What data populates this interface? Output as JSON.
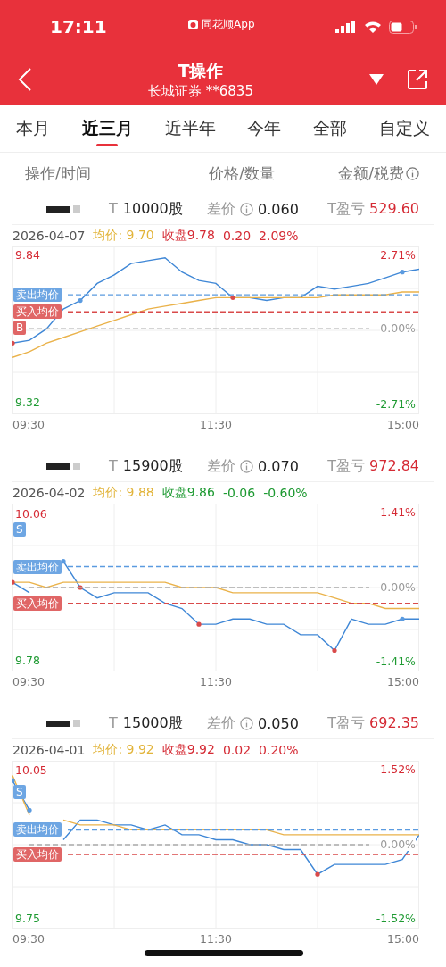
{
  "status_bar": {
    "time": "17:11",
    "app_label": "同花顺App"
  },
  "header": {
    "title": "T操作",
    "subtitle": "长城证券 **6835"
  },
  "tabs": [
    {
      "label": "本月",
      "selected": false
    },
    {
      "label": "近三月",
      "selected": true
    },
    {
      "label": "近半年",
      "selected": false
    },
    {
      "label": "今年",
      "selected": false
    },
    {
      "label": "全部",
      "selected": false
    },
    {
      "label": "自定义",
      "selected": false
    }
  ],
  "columns": [
    "操作/时间",
    "价格/数量",
    "金额/税费"
  ],
  "trades": [
    {
      "prefix": "T",
      "quantity": "10000股",
      "spread_label": "差价",
      "spread": "0.060",
      "pnl_label": "T盈亏",
      "pnl": "529.60",
      "date": "2026-04-07",
      "avg_label": "均价:",
      "avg": "9.70",
      "close_label": "收盘",
      "close": "9.78",
      "change": "0.20",
      "change_pct": "2.09%",
      "rising": true,
      "high_pct": "2.71%",
      "low_pct": "-2.71%",
      "marker": "B",
      "times": [
        "09:30",
        "11:30",
        "15:00"
      ],
      "chart_data": {
        "type": "line",
        "grid": true,
        "series": [
          {
            "color": "#3f87d6",
            "values": [
              9.53,
              9.54,
              9.58,
              9.65,
              9.68,
              9.74,
              9.77,
              9.81,
              9.82,
              9.83,
              9.78,
              9.75,
              9.74,
              9.69,
              9.69,
              9.68,
              9.69,
              9.69,
              9.73,
              9.72,
              9.73,
              9.74,
              9.76,
              9.78,
              9.79
            ]
          },
          {
            "color": "#eab24a",
            "values": [
              9.48,
              9.5,
              9.53,
              9.55,
              9.57,
              9.59,
              9.61,
              9.63,
              9.65,
              9.66,
              9.67,
              9.68,
              9.69,
              9.69,
              9.69,
              9.69,
              9.69,
              9.69,
              9.69,
              9.7,
              9.7,
              9.7,
              9.7,
              9.71,
              9.71
            ]
          }
        ],
        "ylim": [
          9.28,
          9.87
        ],
        "yticks": [
          {
            "value": 9.32,
            "label": "9.32"
          },
          {
            "value": 9.84,
            "label": "9.84"
          }
        ]
      },
      "zero_pct": "0.00%",
      "sell_avg_label": "卖出均价",
      "buy_avg_label": "买入均价"
    },
    {
      "prefix": "T",
      "quantity": "15900股",
      "spread_label": "差价",
      "spread": "0.070",
      "pnl_label": "T盈亏",
      "pnl": "972.84",
      "date": "2026-04-02",
      "avg_label": "均价:",
      "avg": "9.88",
      "close_label": "收盘",
      "close": "9.86",
      "change": "-0.06",
      "change_pct": "-0.60%",
      "rising": false,
      "high_pct": "1.41%",
      "low_pct": "-1.41%",
      "marker": "S",
      "times": [
        "09:30",
        "11:30",
        "15:00"
      ],
      "chart_data": {
        "type": "line",
        "grid": true,
        "series": [
          {
            "color": "#3f87d6",
            "values": [
              9.93,
              9.91,
              null,
              9.97,
              9.92,
              9.9,
              9.91,
              9.91,
              9.91,
              9.89,
              9.88,
              9.85,
              9.85,
              9.86,
              9.86,
              9.85,
              9.85,
              9.83,
              9.83,
              9.8,
              9.86,
              9.85,
              9.85,
              9.86,
              9.86
            ]
          },
          {
            "color": "#eab24a",
            "values": [
              9.93,
              9.93,
              9.92,
              9.93,
              9.93,
              9.93,
              9.93,
              9.93,
              9.93,
              9.93,
              9.92,
              9.92,
              9.92,
              9.91,
              9.91,
              9.91,
              9.91,
              9.91,
              9.91,
              9.9,
              9.89,
              9.89,
              9.88,
              9.88,
              9.88
            ]
          }
        ],
        "ylim": [
          9.76,
          10.08
        ],
        "yticks": [
          {
            "value": 9.78,
            "label": "9.78"
          },
          {
            "value": 10.06,
            "label": "10.06"
          }
        ]
      },
      "zero_pct": "0.00%",
      "sell_avg_label": "卖出均价",
      "buy_avg_label": "买入均价"
    },
    {
      "prefix": "T",
      "quantity": "15000股",
      "spread_label": "差价",
      "spread": "0.050",
      "pnl_label": "T盈亏",
      "pnl": "692.35",
      "date": "2026-04-01",
      "avg_label": "均价:",
      "avg": "9.92",
      "close_label": "收盘",
      "close": "9.92",
      "change": "0.02",
      "change_pct": "0.20%",
      "rising": true,
      "high_pct": "1.52%",
      "low_pct": "-1.52%",
      "marker": "S",
      "times": [
        "09:30",
        "11:30",
        "15:00"
      ],
      "chart_data": {
        "type": "line",
        "grid": true,
        "series": [
          {
            "color": "#3f87d6",
            "values": [
              10.03,
              9.97,
              null,
              9.91,
              9.95,
              9.95,
              9.94,
              9.94,
              9.93,
              9.94,
              9.92,
              9.92,
              9.91,
              9.91,
              9.9,
              9.9,
              9.89,
              9.89,
              9.84,
              9.86,
              9.86,
              9.86,
              9.86,
              9.87,
              9.92
            ]
          },
          {
            "color": "#eab24a",
            "values": [
              10.04,
              9.96,
              null,
              9.95,
              9.94,
              9.94,
              9.94,
              9.93,
              9.93,
              9.93,
              9.93,
              9.93,
              9.93,
              9.93,
              9.93,
              9.93,
              9.92,
              9.92,
              9.92,
              9.92,
              9.92,
              9.92,
              9.92,
              9.92,
              9.92
            ]
          }
        ],
        "ylim": [
          9.73,
          10.07
        ],
        "yticks": [
          {
            "value": 9.75,
            "label": "9.75"
          },
          {
            "value": 10.05,
            "label": "10.05"
          }
        ]
      },
      "zero_pct": "0.00%",
      "sell_avg_label": "卖出均价",
      "buy_avg_label": "买入均价"
    }
  ]
}
